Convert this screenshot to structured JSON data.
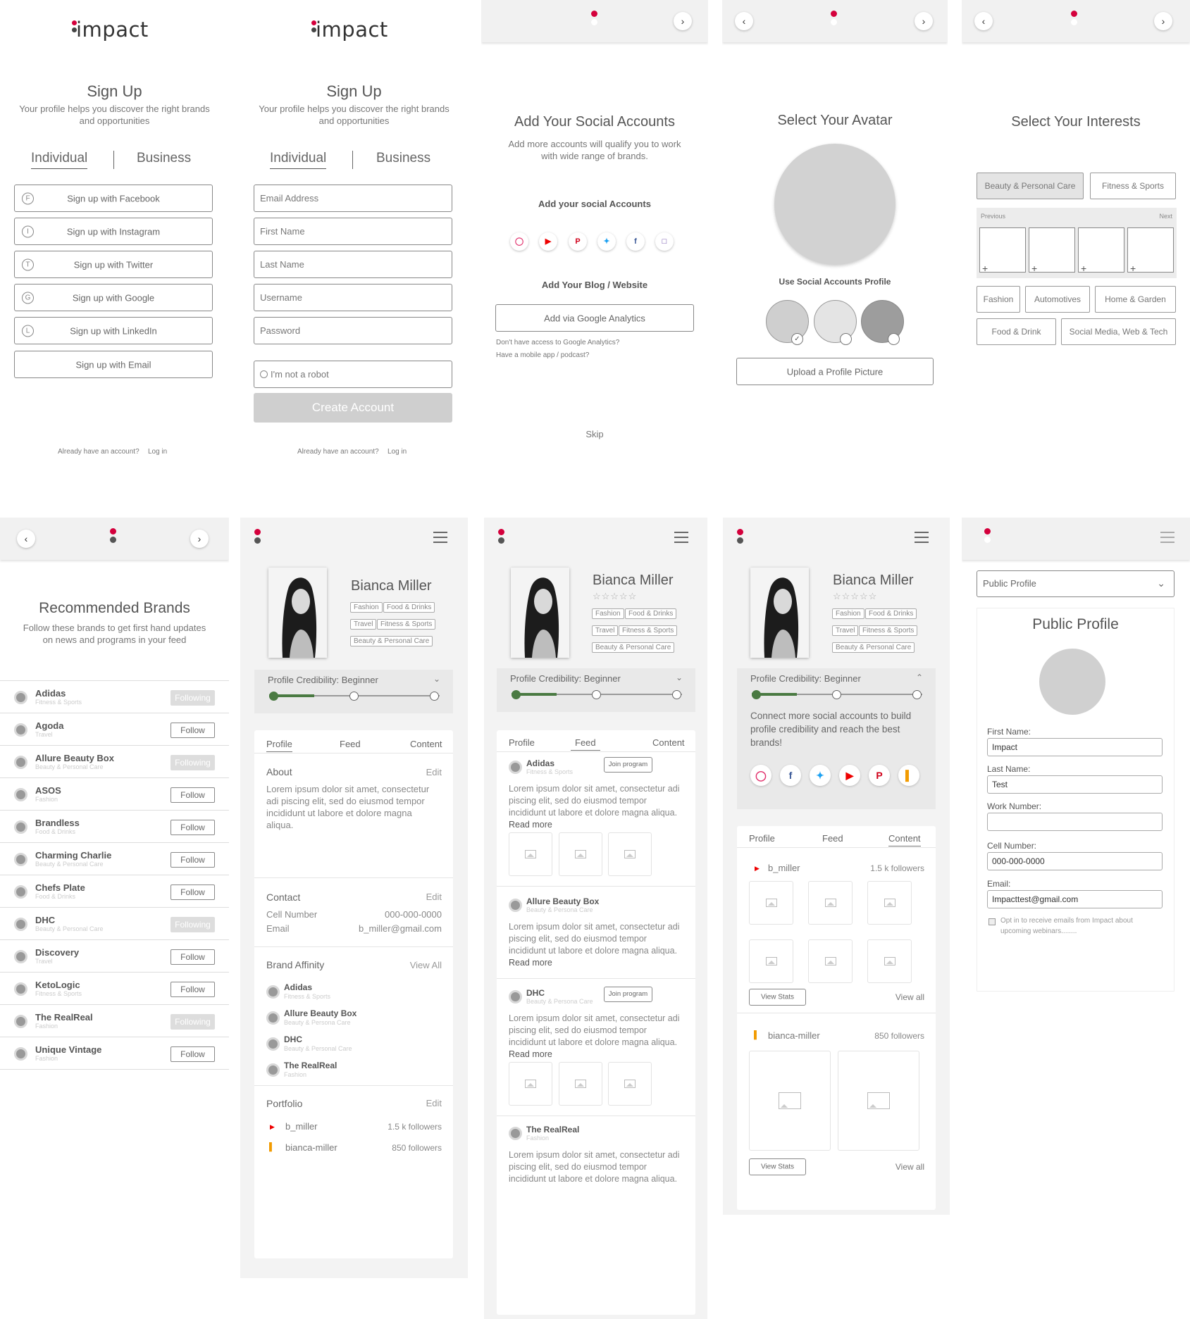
{
  "brand": {
    "logo_text": "impact",
    "accent": "#d4003c"
  },
  "signup": {
    "title": "Sign Up",
    "subtitle_1": "Your profile helps you discover the right brands",
    "subtitle_2": "and opportunities",
    "tab_individual": "Individual",
    "tab_business": "Business",
    "social_buttons": [
      {
        "letter": "F",
        "label": "Sign up with Facebook"
      },
      {
        "letter": "I",
        "label": "Sign up with Instagram"
      },
      {
        "letter": "T",
        "label": "Sign up with Twitter"
      },
      {
        "letter": "G",
        "label": "Sign up with Google"
      },
      {
        "letter": "L",
        "label": "Sign up with LinkedIn"
      }
    ],
    "email_button": "Sign up with Email",
    "have_account": "Already have an account?",
    "login": "Log in"
  },
  "signup_form": {
    "placeholders": [
      "Email Address",
      "First Name",
      "Last Name",
      "Username",
      "Password"
    ],
    "captcha": "I'm not a robot",
    "create": "Create Account"
  },
  "social": {
    "title": "Add Your Social Accounts",
    "subtitle_1": "Add more accounts will qualify you to work",
    "subtitle_2": "with wide range of brands.",
    "accounts_heading": "Add your social Accounts",
    "blog_heading": "Add Your Blog / Website",
    "analytics_button": "Add via Google Analytics",
    "no_analytics": "Don't have access to Google Analytics?",
    "mobile_app": "Have a mobile app / podcast?",
    "skip": "Skip"
  },
  "avatar": {
    "title": "Select Your Avatar",
    "use_social": "Use Social Accounts Profile",
    "upload": "Upload a Profile Picture"
  },
  "interests": {
    "title": "Select Your Interests",
    "top_chips": [
      "Beauty & Personal Care",
      "Fitness & Sports"
    ],
    "previous": "Previous",
    "next": "Next",
    "add": "+",
    "chips_row1": [
      "Fashion",
      "Automotives",
      "Home & Garden"
    ],
    "chips_row2": [
      "Food & Drink",
      "Social Media, Web & Tech"
    ]
  },
  "brands": {
    "title": "Recommended Brands",
    "subtitle_1": "Follow these brands to get first hand updates",
    "subtitle_2": "on news and programs in your feed",
    "list": [
      {
        "name": "Adidas",
        "category": "Fitness & Sports",
        "action": "Following"
      },
      {
        "name": "Agoda",
        "category": "Travel",
        "action": "Follow"
      },
      {
        "name": "Allure Beauty Box",
        "category": "Beauty & Personal Care",
        "action": "Following"
      },
      {
        "name": "ASOS",
        "category": "Fashion",
        "action": "Follow"
      },
      {
        "name": "Brandless",
        "category": "Food & Drinks",
        "action": "Follow"
      },
      {
        "name": "Charming Charlie",
        "category": "Beauty & Personal Care",
        "action": "Follow"
      },
      {
        "name": "Chefs Plate",
        "category": "Food & Drinks",
        "action": "Follow"
      },
      {
        "name": "DHC",
        "category": "Beauty & Personal Care",
        "action": "Following"
      },
      {
        "name": "Discovery",
        "category": "Travel",
        "action": "Follow"
      },
      {
        "name": "KetoLogic",
        "category": "Fitness & Sports",
        "action": "Follow"
      },
      {
        "name": "The RealReal",
        "category": "Fashion",
        "action": "Following"
      },
      {
        "name": "Unique Vintage",
        "category": "Fashion",
        "action": "Follow"
      }
    ]
  },
  "profile": {
    "name": "Bianca Miller",
    "tags": [
      "Fashion",
      "Food & Drinks",
      "Travel",
      "Fitness & Sports",
      "Beauty & Personal Care"
    ],
    "stars": "☆☆☆☆☆",
    "credibility": "Profile Credibility: Beginner",
    "credibility_tip": "Connect more social accounts to build profile credibility and reach the best brands!",
    "tabs": [
      "Profile",
      "Feed",
      "Content"
    ],
    "about_title": "About",
    "edit": "Edit",
    "lorem": "Lorem ipsum dolor sit amet, consectetur adi piscing elit, sed do eiusmod tempor incididunt ut labore et dolore magna aliqua.",
    "contact_title": "Contact",
    "cell_label": "Cell Number",
    "cell_value": "000-000-0000",
    "email_label": "Email",
    "email_value": "b_miller@gmail.com",
    "affinity_title": "Brand Affinity",
    "view_all_caps": "View All",
    "affinity": [
      {
        "name": "Adidas",
        "category": "Fitness & Sports"
      },
      {
        "name": "Allure Beauty Box",
        "category": "Beauty & Persona Care"
      },
      {
        "name": "DHC",
        "category": "Beauty & Personal Care"
      },
      {
        "name": "The RealReal",
        "category": "Fashion"
      }
    ],
    "portfolio_title": "Portfolio",
    "portfolio": [
      {
        "handle": "b_miller",
        "followers": "1.5 k followers"
      },
      {
        "handle": "bianca-miller",
        "followers": "850 followers"
      }
    ]
  },
  "feed": {
    "join": "Join program",
    "read_more": "Read more",
    "lorem": "Lorem ipsum dolor sit amet, consectetur adi piscing elit, sed do eiusmod tempor incididunt ut labore et dolore magna aliqua.",
    "posts": [
      {
        "name": "Adidas",
        "category": "Fitness & Sports"
      },
      {
        "name": "Allure Beauty Box",
        "category": "Beauty & Persona Care"
      },
      {
        "name": "DHC",
        "category": "Beauty & Persona Care"
      },
      {
        "name": "The RealReal",
        "category": "Fashion"
      }
    ]
  },
  "content": {
    "view_stats": "View Stats",
    "view_all": "View all"
  },
  "public": {
    "select_value": "Public Profile",
    "title": "Public Profile",
    "first_label": "First Name:",
    "first_value": "Impact",
    "last_label": "Last Name:",
    "last_value": "Test",
    "work_label": "Work Number:",
    "work_value": "",
    "cell_label": "Cell Number:",
    "cell_value": "000-000-0000",
    "email_label": "Email:",
    "email_value": "Impacttest@gmail.com",
    "opt_in_1": "Opt in to receive emails from Impact about",
    "opt_in_2": "upcoming webinars........"
  }
}
